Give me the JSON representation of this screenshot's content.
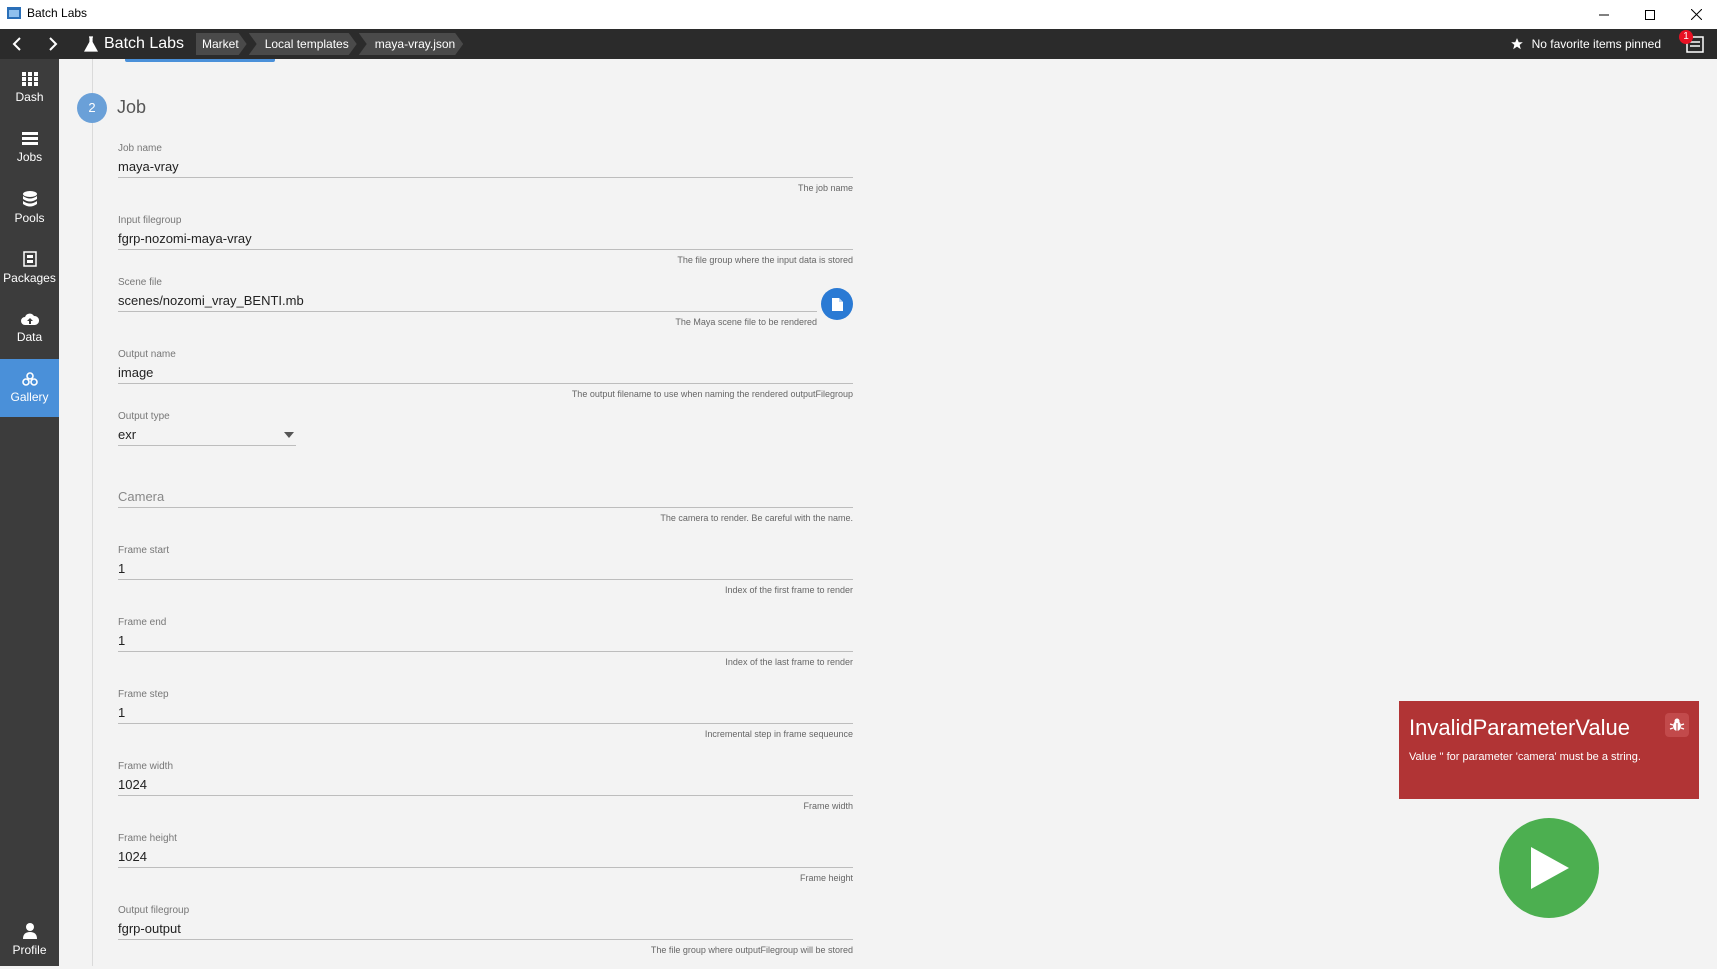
{
  "window": {
    "title": "Batch Labs",
    "minimize_icon": "minimize-icon",
    "maximize_icon": "maximize-icon",
    "close_icon": "close-icon"
  },
  "topbar": {
    "back_icon": "chevron-left-icon",
    "forward_icon": "chevron-right-icon",
    "brand": "Batch Labs",
    "breadcrumbs": [
      "Market",
      "Local templates",
      "maya-vray.json"
    ],
    "pins_text": "No favorite items pinned",
    "notification_count": "1"
  },
  "sidebar": {
    "items": [
      {
        "label": "Dash",
        "icon": "grid-icon"
      },
      {
        "label": "Jobs",
        "icon": "list-icon"
      },
      {
        "label": "Pools",
        "icon": "database-icon"
      },
      {
        "label": "Packages",
        "icon": "package-icon"
      },
      {
        "label": "Data",
        "icon": "cloud-upload-icon"
      },
      {
        "label": "Gallery",
        "icon": "gallery-icon",
        "active": true
      }
    ],
    "profile": {
      "label": "Profile",
      "icon": "person-icon"
    }
  },
  "form": {
    "step_number": "2",
    "step_title": "Job",
    "fields": {
      "job_name": {
        "label": "Job name",
        "value": "maya-vray",
        "hint": "The job name"
      },
      "input_filegroup": {
        "label": "Input filegroup",
        "value": "fgrp-nozomi-maya-vray",
        "hint": "The file group where the input data is stored"
      },
      "scene_file": {
        "label": "Scene file",
        "value": "scenes/nozomi_vray_BENTI.mb",
        "hint": "The Maya scene file to be rendered"
      },
      "output_name": {
        "label": "Output name",
        "value": "image",
        "hint": "The output filename to use when naming the rendered outputFilegroup"
      },
      "output_type": {
        "label": "Output type",
        "value": "exr"
      },
      "camera": {
        "placeholder": "Camera",
        "hint": "The camera to render. Be careful with the name."
      },
      "frame_start": {
        "label": "Frame start",
        "value": "1",
        "hint": "Index of the first frame to render"
      },
      "frame_end": {
        "label": "Frame end",
        "value": "1",
        "hint": "Index of the last frame to render"
      },
      "frame_step": {
        "label": "Frame step",
        "value": "1",
        "hint": "Incremental step in frame sequeunce"
      },
      "frame_width": {
        "label": "Frame width",
        "value": "1024",
        "hint": "Frame width"
      },
      "frame_height": {
        "label": "Frame height",
        "value": "1024",
        "hint": "Frame height"
      },
      "output_filegroup": {
        "label": "Output filegroup",
        "value": "fgrp-output",
        "hint": "The file group where outputFilegroup will be stored"
      }
    }
  },
  "error_toast": {
    "title": "InvalidParameterValue",
    "message": "Value '' for parameter 'camera' must be a string.",
    "icon": "bug-icon"
  },
  "run_button": {
    "icon": "play-icon"
  },
  "colors": {
    "accent": "#4a90d9",
    "error": "#b13435",
    "run": "#4caf50",
    "topbar": "#2b2b2b",
    "sidebar": "#3c3c3c"
  }
}
